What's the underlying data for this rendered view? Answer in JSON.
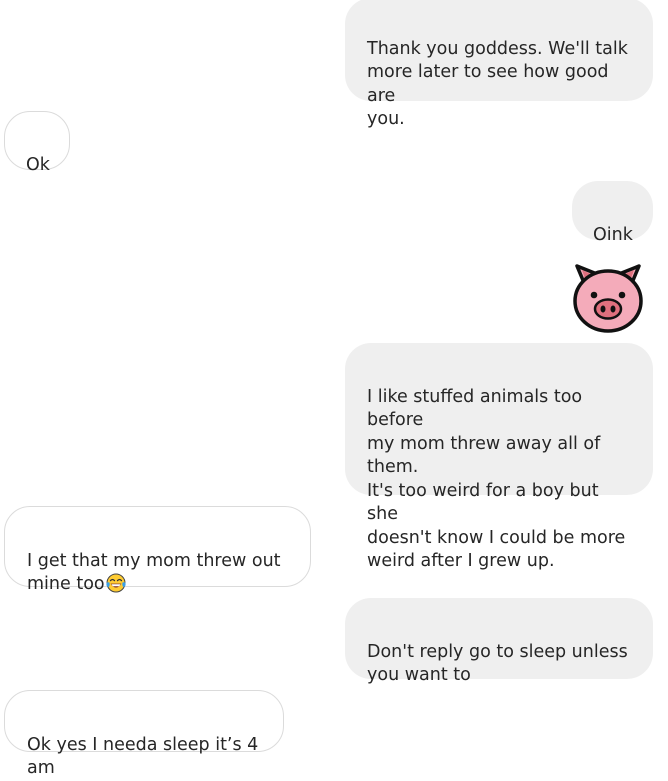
{
  "thread": {
    "messages": [
      {
        "id": "m1",
        "direction": "sent",
        "text": "Thank you goddess. We'll talk\nmore later to see how good are\nyou."
      },
      {
        "id": "m2",
        "direction": "received",
        "text": "Ok"
      },
      {
        "id": "m3",
        "direction": "sent",
        "text": "Oink"
      },
      {
        "id": "m4",
        "direction": "sent",
        "emoji": "pig-face"
      },
      {
        "id": "m5",
        "direction": "sent",
        "text": "I like stuffed animals too before\nmy mom threw away all of them.\nIt's too weird for a boy but she\ndoesn't know I could be more\nweird after I grew up."
      },
      {
        "id": "m6",
        "direction": "received",
        "text": "I get that my mom threw out\nmine too",
        "trailing_emoji": "face-with-tears-of-joy"
      },
      {
        "id": "m7",
        "direction": "sent",
        "text": "Don't reply go to sleep unless\nyou want to"
      },
      {
        "id": "m8",
        "direction": "received",
        "text": "Ok yes I needa sleep it’s 4 am"
      }
    ]
  },
  "colors": {
    "sent_bubble": "#efefef",
    "received_bubble": "#ffffff",
    "received_border": "#dbdbdb",
    "text": "#262626"
  }
}
